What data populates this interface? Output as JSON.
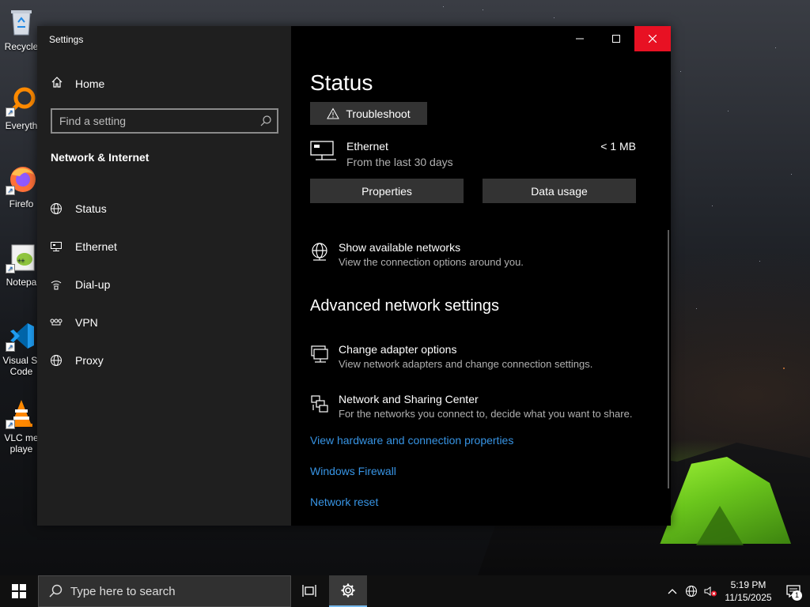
{
  "desktop": {
    "icons": [
      {
        "label": "Recycle",
        "icon": "recycle-bin-icon"
      },
      {
        "label": "Everyth",
        "icon": "everything-search-icon"
      },
      {
        "label": "Firefo",
        "icon": "firefox-icon"
      },
      {
        "label": "Notepa",
        "icon": "notepad-plus-plus-icon"
      },
      {
        "label": "Visual St Code",
        "icon": "vscode-icon"
      },
      {
        "label": "VLC me playe",
        "icon": "vlc-icon"
      }
    ]
  },
  "window": {
    "app_title": "Settings",
    "left": {
      "home_label": "Home",
      "search_placeholder": "Find a setting",
      "section_title": "Network & Internet",
      "nav": [
        {
          "label": "Status",
          "icon": "globe-icon"
        },
        {
          "label": "Ethernet",
          "icon": "ethernet-icon"
        },
        {
          "label": "Dial-up",
          "icon": "dial-up-icon"
        },
        {
          "label": "VPN",
          "icon": "vpn-icon"
        },
        {
          "label": "Proxy",
          "icon": "globe-icon"
        }
      ]
    },
    "content": {
      "page_title": "Status",
      "troubleshoot_label": "Troubleshoot",
      "ethernet": {
        "name": "Ethernet",
        "sub": "From the last 30 days",
        "usage": "< 1 MB"
      },
      "properties_label": "Properties",
      "data_usage_label": "Data usage",
      "show_networks": {
        "title": "Show available networks",
        "sub": "View the connection options around you."
      },
      "advanced_heading": "Advanced network settings",
      "adapter": {
        "title": "Change adapter options",
        "sub": "View network adapters and change connection settings."
      },
      "sharing": {
        "title": "Network and Sharing Center",
        "sub": "For the networks you connect to, decide what you want to share."
      },
      "links": [
        "View hardware and connection properties",
        "Windows Firewall",
        "Network reset"
      ]
    }
  },
  "taskbar": {
    "search_placeholder": "Type here to search",
    "time": "5:19 PM",
    "date": "11/15/2025",
    "notification_count": "1"
  },
  "colors": {
    "accent": "#0078d4",
    "link": "#3794e4",
    "close": "#e81123"
  }
}
